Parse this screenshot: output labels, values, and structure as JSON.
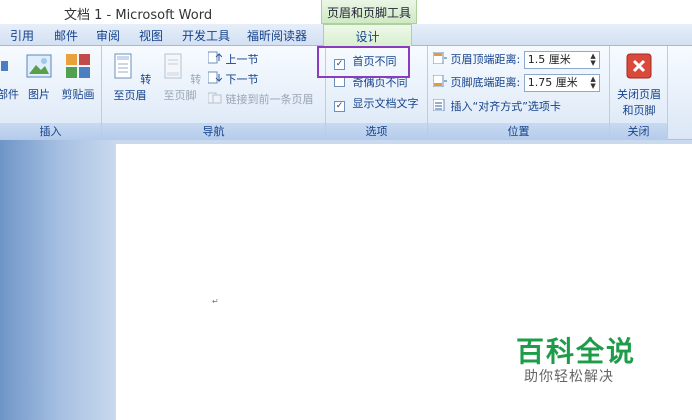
{
  "window": {
    "title": "文档 1 - Microsoft Word",
    "context_tab_group": "页眉和页脚工具"
  },
  "tabs": [
    {
      "label": "引用"
    },
    {
      "label": "邮件"
    },
    {
      "label": "审阅"
    },
    {
      "label": "视图"
    },
    {
      "label": "开发工具"
    },
    {
      "label": "福昕阅读器"
    },
    {
      "label": "设计",
      "active": true
    }
  ],
  "groups": {
    "insert": {
      "label": "插入",
      "buttons": [
        "部件",
        "图片",
        "剪贴画"
      ]
    },
    "navigation": {
      "label": "导航",
      "goto_header": "转至页眉",
      "goto_footer": "转至页脚",
      "previous": "上一节",
      "next": "下一节",
      "link_previous": "链接到前一条页眉"
    },
    "options": {
      "label": "选项",
      "different_first_page": {
        "label": "首页不同",
        "checked": true
      },
      "different_odd_even": {
        "label": "奇偶页不同",
        "checked": false
      },
      "show_document_text": {
        "label": "显示文档文字",
        "checked": true
      }
    },
    "position": {
      "label": "位置",
      "header_from_top_label": "页眉顶端距离:",
      "header_from_top_value": "1.5 厘米",
      "footer_from_bottom_label": "页脚底端距离:",
      "footer_from_bottom_value": "1.75 厘米",
      "insert_alignment_tab": "插入“对齐方式”选项卡"
    },
    "close": {
      "label": "关闭",
      "button_line1": "关闭页眉",
      "button_line2": "和页脚"
    }
  },
  "document": {
    "paragraph_mark": "↵"
  },
  "watermark": {
    "title": "百科全说",
    "subtitle": "助你轻松解决"
  },
  "colors": {
    "ribbon_text": "#15428b",
    "highlight_border": "#8b3bbd",
    "watermark_green": "#1e9c4a",
    "context_tab_green": "#cfe9c5"
  }
}
